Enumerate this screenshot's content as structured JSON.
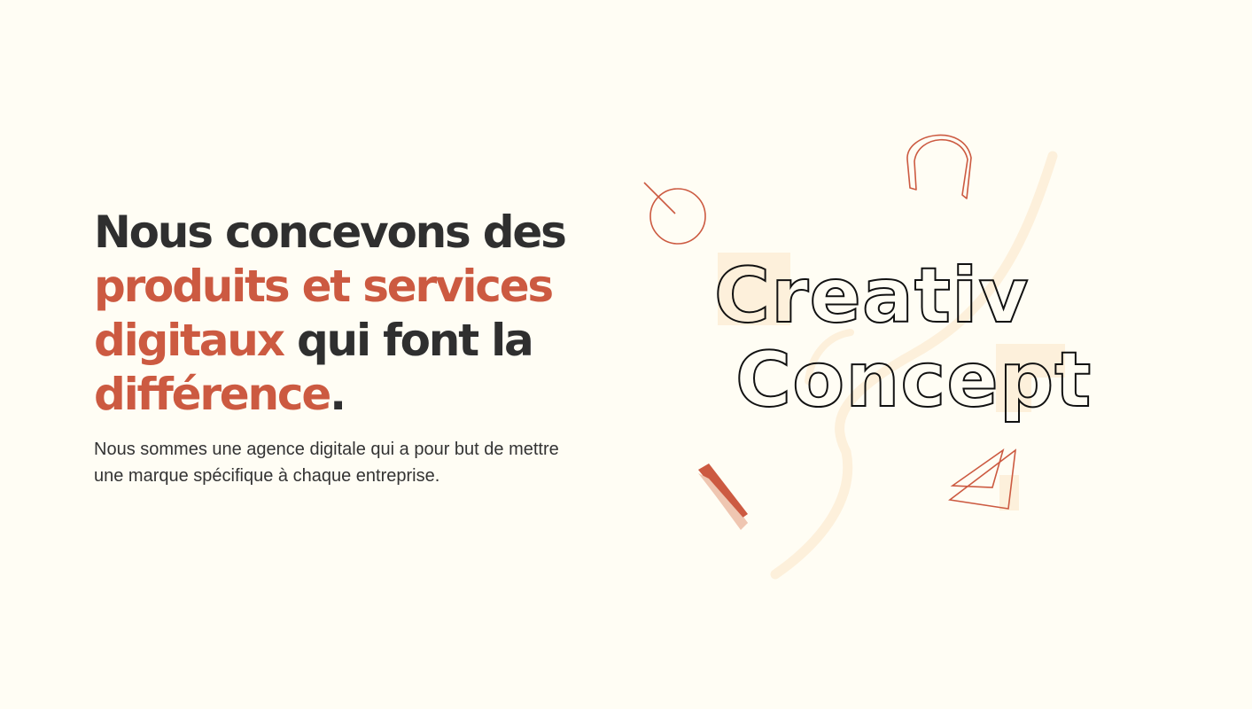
{
  "hero": {
    "headline": {
      "part1": "Nous concevons des ",
      "accent1": "produits et services digitaux",
      "part2": " qui font la ",
      "accent2": "différence",
      "end": "."
    },
    "subtitle": "Nous sommes une agence digitale qui a pour but de mettre une marque spécifique à chaque entreprise."
  },
  "logo": {
    "line1": "Creativ",
    "line2": "Concept"
  },
  "colors": {
    "background": "#fffdf4",
    "text": "#2f2f2f",
    "accent": "#cc5a41",
    "accent_light": "#efc6b1",
    "decor_cream": "#fdf0db"
  }
}
